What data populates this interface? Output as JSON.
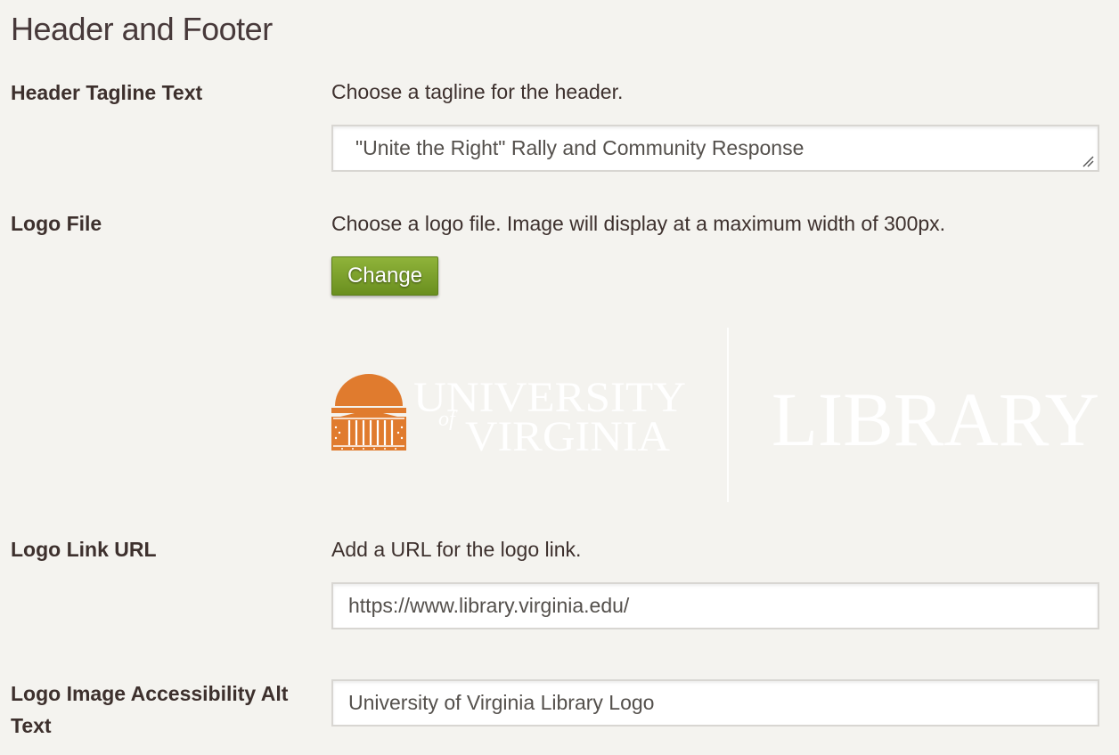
{
  "section": {
    "title": "Header and Footer"
  },
  "tagline": {
    "label": "Header Tagline Text",
    "description": "Choose a tagline for the header.",
    "value": "\"Unite the Right\" Rally and Community Response"
  },
  "logo_file": {
    "label": "Logo File",
    "description": "Choose a logo file. Image will display at a maximum width of 300px.",
    "button_label": "Change",
    "preview": {
      "wordmark_line1": "UNIVERSITY",
      "wordmark_of": "of",
      "wordmark_line2": "VIRGINIA",
      "library_text": "LIBRARY",
      "icon": "rotunda-icon",
      "icon_color": "#e07b2e"
    }
  },
  "logo_link": {
    "label": "Logo Link URL",
    "description": "Add a URL for the logo link.",
    "value": "https://www.library.virginia.edu/"
  },
  "logo_alt": {
    "label": "Logo Image Accessibility Alt Text",
    "value": "University of Virginia Library Logo"
  },
  "colors": {
    "background": "#f4f3ef",
    "button_green": "#7aa02b",
    "logo_orange": "#e07b2e"
  }
}
